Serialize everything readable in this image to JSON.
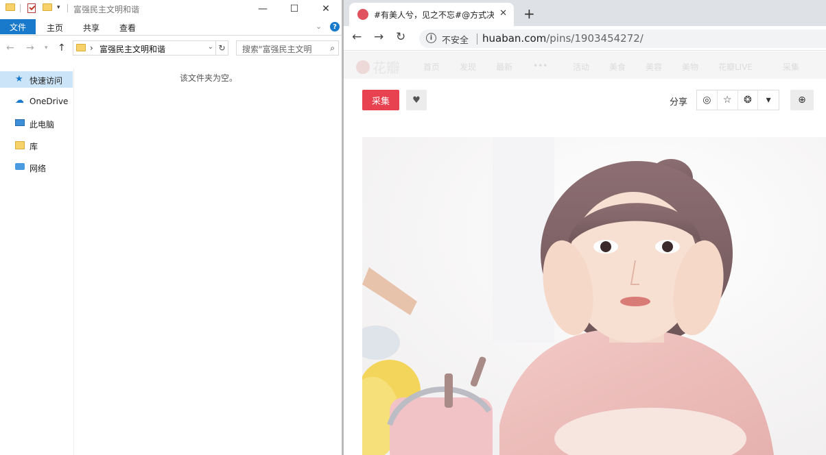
{
  "explorer": {
    "window_title": "富强民主文明和谐",
    "ribbon_tabs": [
      "文件",
      "主页",
      "共享",
      "查看"
    ],
    "address_crumb": "富强民主文明和谐",
    "search_placeholder": "搜索\"富强民主文明",
    "sidebar": [
      {
        "label": "快速访问",
        "icon": "star-icon"
      },
      {
        "label": "OneDrive",
        "icon": "cloud-icon"
      },
      {
        "label": "此电脑",
        "icon": "computer-icon"
      },
      {
        "label": "库",
        "icon": "library-icon"
      },
      {
        "label": "网络",
        "icon": "network-icon"
      }
    ],
    "empty_message": "该文件夹为空。"
  },
  "browser": {
    "tab_title": "#有美人兮，见之不忘#@方式决",
    "security_label": "不安全",
    "url_host": "huaban.com",
    "url_path": "/pins/1903454272/",
    "site": {
      "logo_text": "花瓣",
      "nav": [
        "首页",
        "发现",
        "最新",
        "•••",
        "活动",
        "美食",
        "美容",
        "美物",
        "花瓣LIVE",
        "采集"
      ],
      "collect_label": "采集",
      "share_label": "分享"
    }
  },
  "colors": {
    "explorer_accent": "#1979ca",
    "collect_red": "#e8414f"
  }
}
